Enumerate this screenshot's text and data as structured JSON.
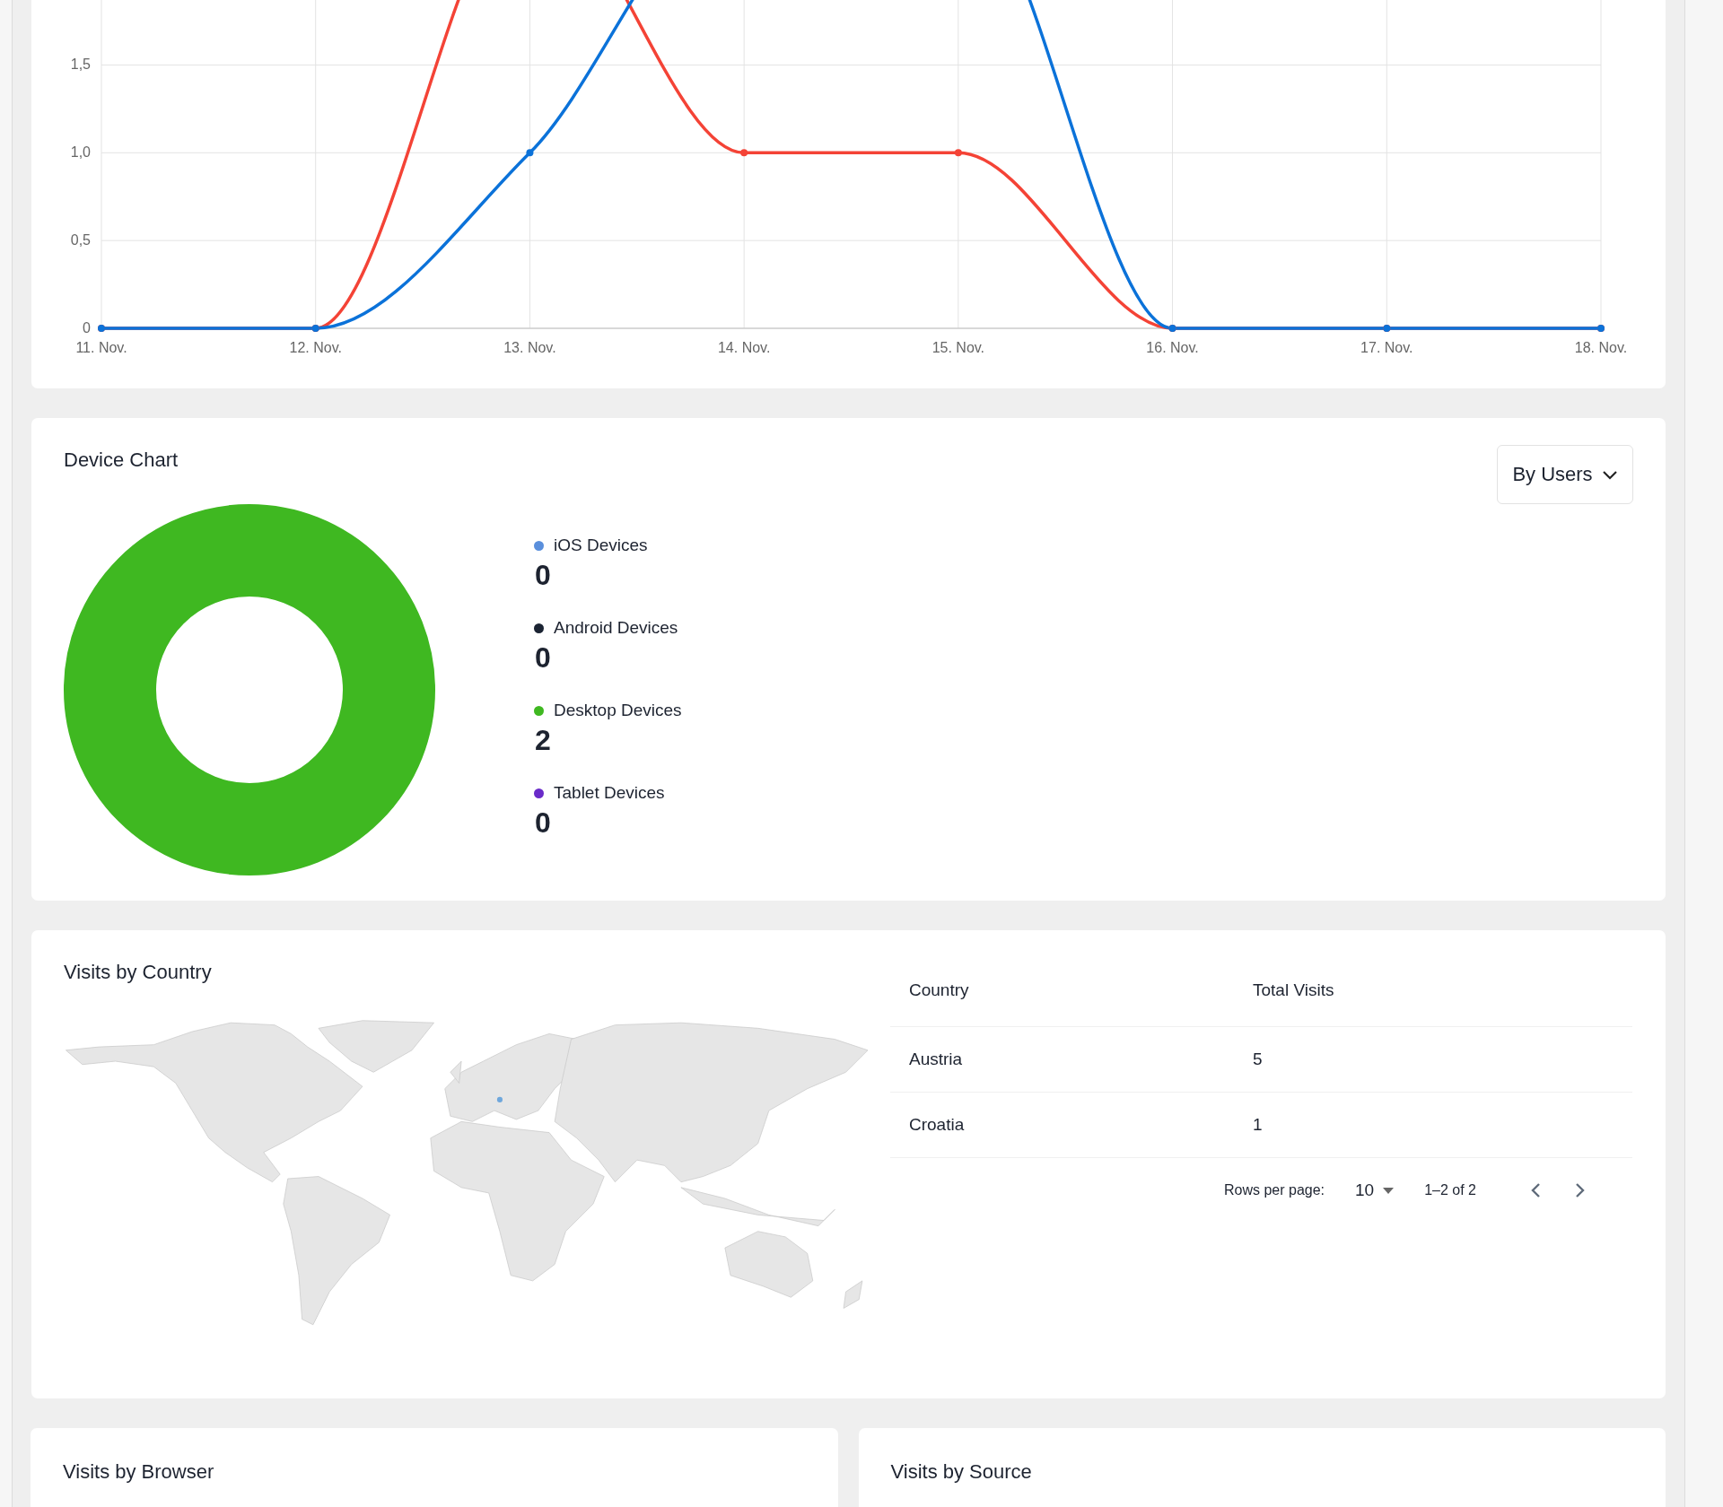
{
  "traffic_chart": {
    "chart_data": {
      "type": "line",
      "grid": true,
      "categories": [
        "11. Nov.",
        "12. Nov.",
        "13. Nov.",
        "14. Nov.",
        "15. Nov.",
        "16. Nov.",
        "17. Nov.",
        "18. Nov."
      ],
      "ylim": [
        0,
        1.87
      ],
      "yticks": [
        {
          "value": 0,
          "label": "0"
        },
        {
          "value": 0.5,
          "label": "0,5"
        },
        {
          "value": 1,
          "label": "1,0"
        },
        {
          "value": 1.5,
          "label": "1,5"
        }
      ],
      "series": [
        {
          "color": "#f44336",
          "marker": true,
          "values": [
            0,
            0,
            null,
            1,
            1,
            0,
            0,
            0
          ]
        },
        {
          "color": "#0b72d9",
          "marker": true,
          "values": [
            0,
            0,
            1,
            null,
            null,
            0,
            0,
            0
          ]
        }
      ]
    }
  },
  "device_chart": {
    "title": "Device Chart",
    "mode_dropdown": {
      "value": "By Users"
    },
    "devices": [
      {
        "label": "iOS Devices",
        "value": "0",
        "color": "#5a8fdc"
      },
      {
        "label": "Android Devices",
        "value": "0",
        "color": "#1b2433"
      },
      {
        "label": "Desktop Devices",
        "value": "2",
        "color": "#3fb821"
      },
      {
        "label": "Tablet Devices",
        "value": "0",
        "color": "#6a2bc9"
      }
    ]
  },
  "visits_by_country": {
    "title": "Visits by Country",
    "table": {
      "columns": [
        "Country",
        "Total Visits"
      ],
      "rows": [
        [
          "Austria",
          "5"
        ],
        [
          "Croatia",
          "1"
        ]
      ]
    },
    "pagination": {
      "rows_per_page_label": "Rows per page:",
      "rows_per_page": "10",
      "range": "1–2 of 2"
    }
  },
  "bottom_cards": [
    {
      "title": "Visits by Browser"
    },
    {
      "title": "Visits by Source"
    }
  ]
}
